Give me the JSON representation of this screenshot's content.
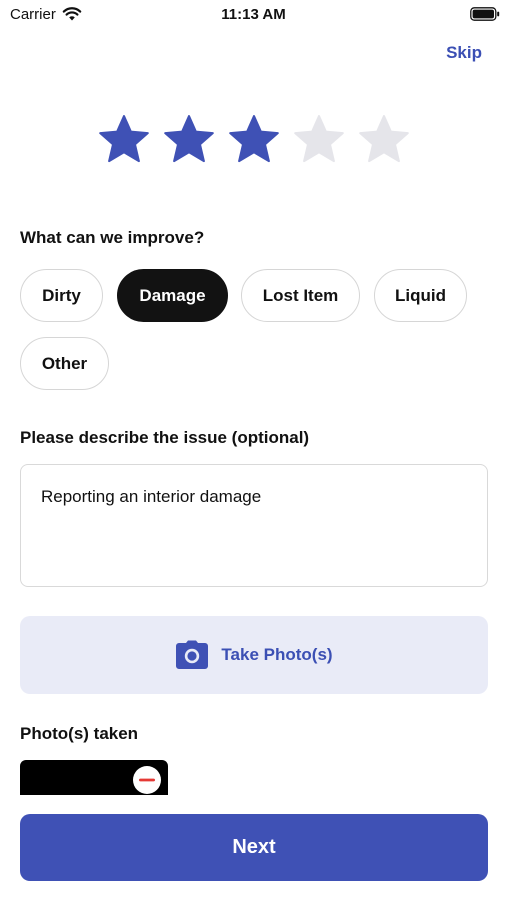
{
  "status_bar": {
    "carrier": "Carrier",
    "time": "11:13 AM",
    "wifi_icon": "wifi-icon",
    "battery_icon": "battery-icon"
  },
  "header": {
    "skip_label": "Skip"
  },
  "rating": {
    "value": 3,
    "max": 5,
    "filled_color": "#3f51b5",
    "empty_color": "#e5e5ea"
  },
  "improve": {
    "label": "What can we improve?",
    "options": [
      "Dirty",
      "Damage",
      "Lost Item",
      "Liquid",
      "Other"
    ],
    "selected": "Damage"
  },
  "description": {
    "label": "Please describe the issue (optional)",
    "value": "Reporting an interior damage"
  },
  "photo_button": {
    "label": "Take Photo(s)",
    "icon": "camera-icon"
  },
  "photos": {
    "label": "Photo(s) taken",
    "remove_icon": "remove-icon"
  },
  "footer": {
    "next_label": "Next"
  },
  "colors": {
    "accent": "#3f51b5",
    "accent_light": "#e9ebf7",
    "selected_chip": "#121212",
    "remove_red": "#e53935"
  }
}
